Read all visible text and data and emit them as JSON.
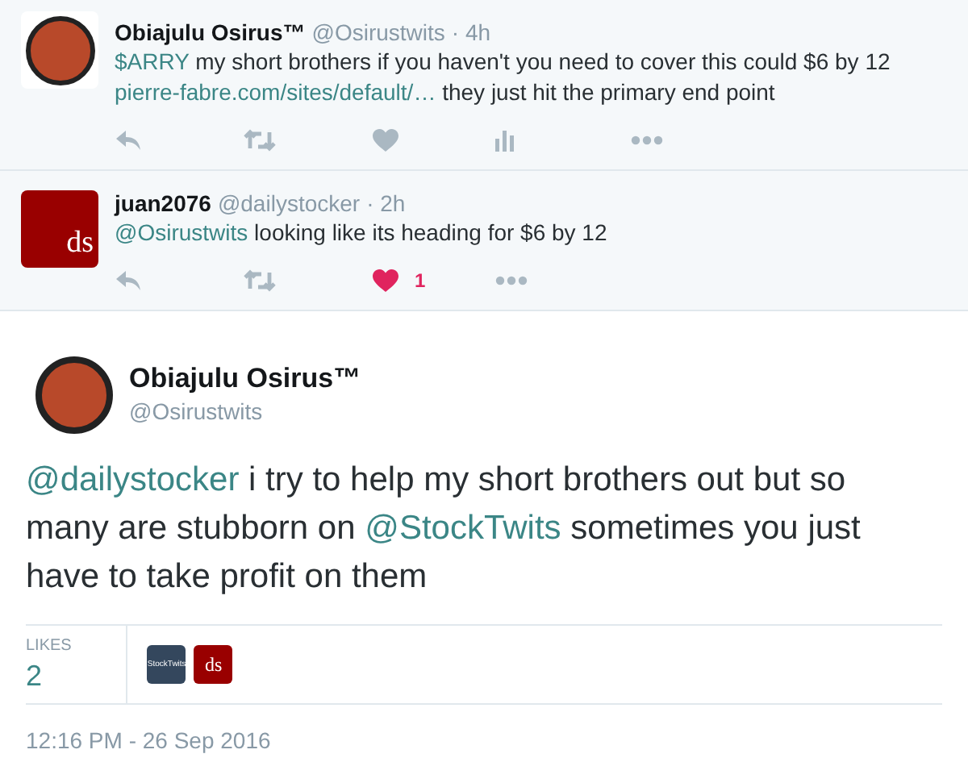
{
  "replies": [
    {
      "name": "Obiajulu Osirus™",
      "handle": "@Osirustwits",
      "time": "· 4h",
      "avatar": {
        "kind": "photo"
      },
      "segments": [
        {
          "kind": "link",
          "text": "$ARRY"
        },
        {
          "kind": "text",
          "text": " my short brothers if you haven't you need to cover this could $6 by 12 "
        },
        {
          "kind": "link",
          "text": "pierre-fabre.com/sites/default/…"
        },
        {
          "kind": "text",
          "text": " they just hit the primary end point"
        }
      ],
      "actions": [
        {
          "kind": "reply"
        },
        {
          "kind": "retweet"
        },
        {
          "kind": "like",
          "liked": false
        },
        {
          "kind": "stats"
        },
        {
          "kind": "more"
        }
      ]
    },
    {
      "name": "juan2076",
      "handle": "@dailystocker",
      "time": "· 2h",
      "avatar": {
        "kind": "logo",
        "text": "ds"
      },
      "segments": [
        {
          "kind": "link",
          "text": "@Osirustwits"
        },
        {
          "kind": "text",
          "text": " looking like its heading for $6 by 12"
        }
      ],
      "actions": [
        {
          "kind": "reply"
        },
        {
          "kind": "retweet"
        },
        {
          "kind": "like",
          "liked": true,
          "count": "1"
        },
        {
          "kind": "more"
        }
      ]
    }
  ],
  "main": {
    "name": "Obiajulu Osirus™",
    "handle": "@Osirustwits",
    "segments": [
      {
        "kind": "link",
        "text": "@dailystocker"
      },
      {
        "kind": "text",
        "text": " i try to help my short brothers out but so many are stubborn on "
      },
      {
        "kind": "link",
        "text": "@StockTwits"
      },
      {
        "kind": "text",
        "text": " sometimes you just have to take profit on them"
      }
    ],
    "likes_label": "LIKES",
    "likes_count": "2",
    "likers": [
      {
        "text": "StockTwits",
        "color": "#34475d"
      },
      {
        "text": "ds",
        "color": "#990000"
      }
    ],
    "timestamp": "12:16 PM - 26 Sep 2016"
  }
}
